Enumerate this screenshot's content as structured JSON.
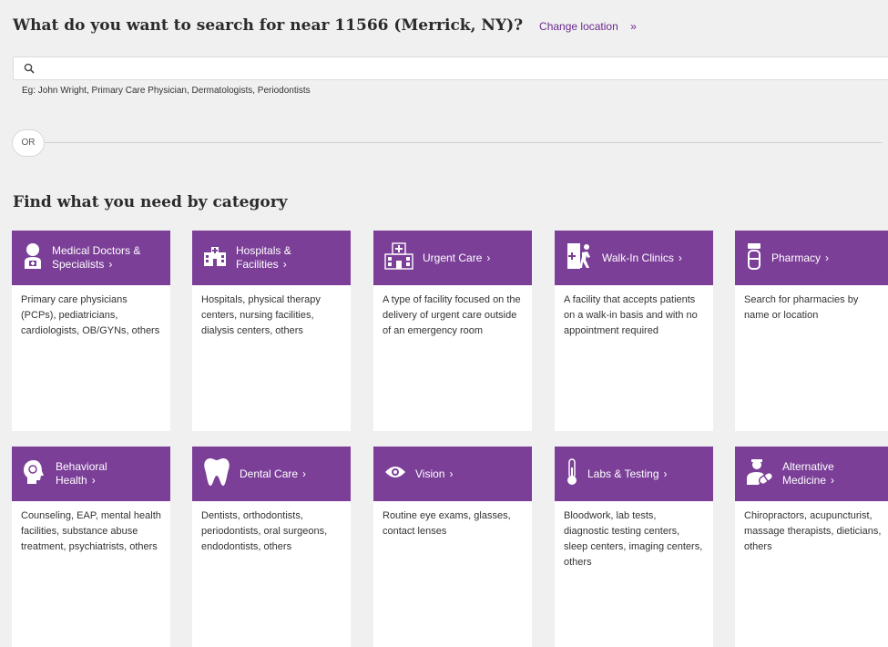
{
  "header": {
    "question": "What do you want to search for near 11566 (Merrick, NY)?",
    "change_location": "Change location",
    "change_arrows": "»"
  },
  "search": {
    "placeholder": "",
    "value": "",
    "example": "Eg: John Wright, Primary Care Physician, Dermatologists, Periodontists"
  },
  "or_label": "OR",
  "section_title": "Find what you need by category",
  "chevron": "›",
  "colors": {
    "accent": "#7b3f98",
    "link": "#6a2a8e",
    "background": "#f0f0f0"
  },
  "categories": [
    {
      "icon": "doctor-icon",
      "title_lines": [
        "Medical Doctors &",
        "Specialists"
      ],
      "desc": "Primary care physicians (PCPs), pediatricians, cardiologists, OB/GYNs, others"
    },
    {
      "icon": "hospital-icon",
      "title_lines": [
        "Hospitals &",
        "Facilities"
      ],
      "desc": "Hospitals, physical therapy centers, nursing facilities, dialysis centers, others"
    },
    {
      "icon": "urgent-care-icon",
      "title_lines": [
        "Urgent Care"
      ],
      "desc": "A type of facility focused on the delivery of urgent care outside of an emergency room"
    },
    {
      "icon": "walk-in-icon",
      "title_lines": [
        "Walk-In Clinics"
      ],
      "desc": "A facility that accepts patients on a walk-in basis and with no appointment required"
    },
    {
      "icon": "pharmacy-icon",
      "title_lines": [
        "Pharmacy"
      ],
      "desc": "Search for pharmacies by name or location"
    },
    {
      "icon": "behavioral-health-icon",
      "title_lines": [
        "Behavioral",
        "Health"
      ],
      "desc": "Counseling, EAP, mental health facilities, substance abuse treatment, psychiatrists, others"
    },
    {
      "icon": "tooth-icon",
      "title_lines": [
        "Dental Care"
      ],
      "desc": "Dentists, orthodontists, periodontists, oral surgeons, endodontists, others"
    },
    {
      "icon": "eye-icon",
      "title_lines": [
        "Vision"
      ],
      "desc": "Routine eye exams, glasses, contact lenses"
    },
    {
      "icon": "thermometer-icon",
      "title_lines": [
        "Labs & Testing"
      ],
      "desc": "Bloodwork, lab tests, diagnostic testing centers, sleep centers, imaging centers, others"
    },
    {
      "icon": "alternative-medicine-icon",
      "title_lines": [
        "Alternative",
        "Medicine"
      ],
      "desc": "Chiropractors, acupuncturist, massage therapists, dieticians, others"
    }
  ]
}
